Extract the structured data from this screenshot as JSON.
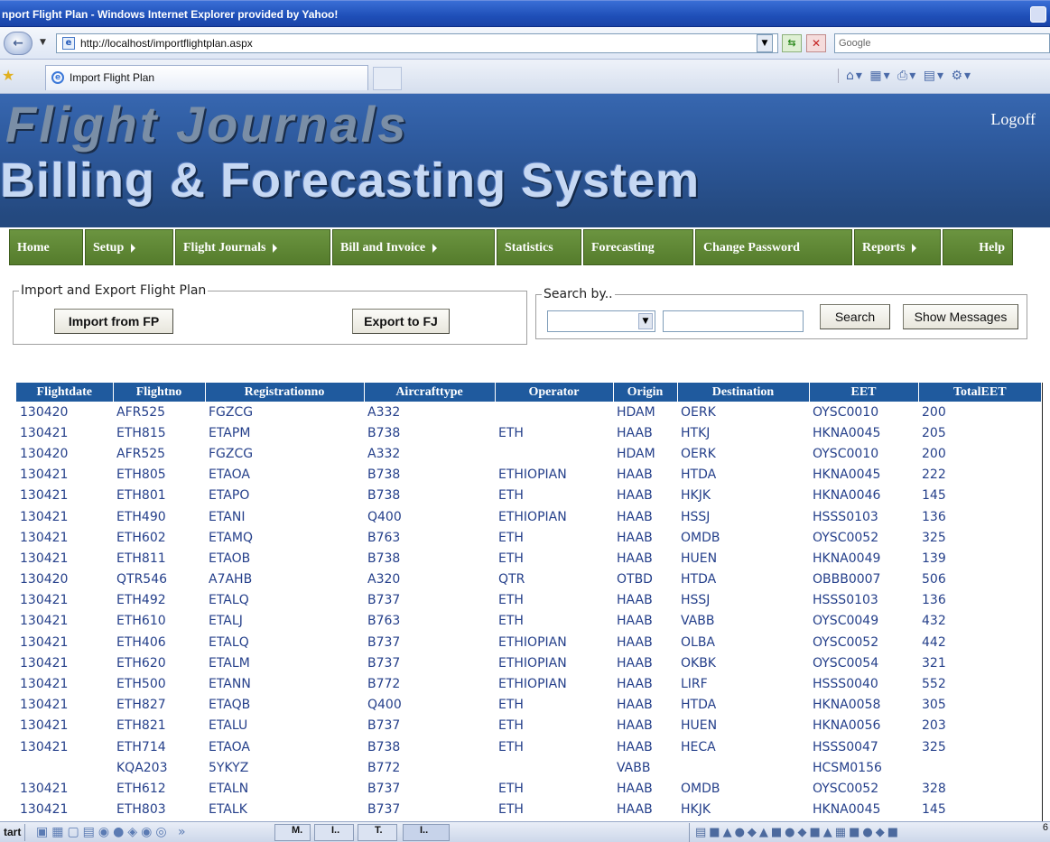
{
  "window": {
    "title": "nport Flight Plan - Windows Internet Explorer provided by Yahoo!"
  },
  "address": {
    "url": "http://localhost/importflightplan.aspx",
    "search_placeholder": "Google"
  },
  "tab": {
    "label": "Import Flight Plan"
  },
  "banner": {
    "line1": "Flight Journals",
    "line2": "Billing & Forecasting System",
    "logoff": "Logoff"
  },
  "menu": [
    {
      "label": "Home",
      "arrow": false
    },
    {
      "label": "Setup",
      "arrow": true
    },
    {
      "label": "Flight Journals",
      "arrow": true
    },
    {
      "label": "Bill and Invoice",
      "arrow": true
    },
    {
      "label": "Statistics",
      "arrow": false
    },
    {
      "label": "Forecasting",
      "arrow": false
    },
    {
      "label": "Change Password",
      "arrow": false
    },
    {
      "label": "Reports",
      "arrow": true
    },
    {
      "label": "Help",
      "arrow": false
    }
  ],
  "import_panel": {
    "legend": "Import and Export Flight Plan",
    "import_button": "Import from FP",
    "export_button": "Export to FJ"
  },
  "search_panel": {
    "legend": "Search by..",
    "search_button": "Search",
    "messages_button": "Show Messages"
  },
  "grid": {
    "columns": [
      "Flightdate",
      "Flightno",
      "Registrationno",
      "Aircrafttype",
      "Operator",
      "Origin",
      "Destination",
      "EET",
      "TotalEET"
    ],
    "rows": [
      [
        "130420",
        "AFR525",
        "FGZCG",
        "A332",
        "",
        "HDAM",
        "OERK",
        "OYSC0010",
        "200"
      ],
      [
        "130421",
        "ETH815",
        "ETAPM",
        "B738",
        "ETH",
        "HAAB",
        "HTKJ",
        "HKNA0045",
        "205"
      ],
      [
        "130420",
        "AFR525",
        "FGZCG",
        "A332",
        "",
        "HDAM",
        "OERK",
        "OYSC0010",
        "200"
      ],
      [
        "130421",
        "ETH805",
        "ETAOA",
        "B738",
        "ETHIOPIAN",
        "HAAB",
        "HTDA",
        "HKNA0045",
        "222"
      ],
      [
        "130421",
        "ETH801",
        "ETAPO",
        "B738",
        "ETH",
        "HAAB",
        "HKJK",
        "HKNA0046",
        "145"
      ],
      [
        "130421",
        "ETH490",
        "ETANI",
        "Q400",
        "ETHIOPIAN",
        "HAAB",
        "HSSJ",
        "HSSS0103",
        "136"
      ],
      [
        "130421",
        "ETH602",
        "ETAMQ",
        "B763",
        "ETH",
        "HAAB",
        "OMDB",
        "OYSC0052",
        "325"
      ],
      [
        "130421",
        "ETH811",
        "ETAOB",
        "B738",
        "ETH",
        "HAAB",
        "HUEN",
        "HKNA0049",
        "139"
      ],
      [
        "130420",
        "QTR546",
        "A7AHB",
        "A320",
        "QTR",
        "OTBD",
        "HTDA",
        "OBBB0007",
        "506"
      ],
      [
        "130421",
        "ETH492",
        "ETALQ",
        "B737",
        "ETH",
        "HAAB",
        "HSSJ",
        "HSSS0103",
        "136"
      ],
      [
        "130421",
        "ETH610",
        "ETALJ",
        "B763",
        "ETH",
        "HAAB",
        "VABB",
        "OYSC0049",
        "432"
      ],
      [
        "130421",
        "ETH406",
        "ETALQ",
        "B737",
        "ETHIOPIAN",
        "HAAB",
        "OLBA",
        "OYSC0052",
        "442"
      ],
      [
        "130421",
        "ETH620",
        "ETALM",
        "B737",
        "ETHIOPIAN",
        "HAAB",
        "OKBK",
        "OYSC0054",
        "321"
      ],
      [
        "130421",
        "ETH500",
        "ETANN",
        "B772",
        "ETHIOPIAN",
        "HAAB",
        "LIRF",
        "HSSS0040",
        "552"
      ],
      [
        "130421",
        "ETH827",
        "ETAQB",
        "Q400",
        "ETH",
        "HAAB",
        "HTDA",
        "HKNA0058",
        "305"
      ],
      [
        "130421",
        "ETH821",
        "ETALU",
        "B737",
        "ETH",
        "HAAB",
        "HUEN",
        "HKNA0056",
        "203"
      ],
      [
        "130421",
        "ETH714",
        "ETAOA",
        "B738",
        "ETH",
        "HAAB",
        "HECA",
        "HSSS0047",
        "325"
      ],
      [
        "",
        "KQA203",
        "5YKYZ",
        "B772",
        "",
        "VABB",
        "",
        "HCSM0156",
        ""
      ],
      [
        "130421",
        "ETH612",
        "ETALN",
        "B737",
        "ETH",
        "HAAB",
        "OMDB",
        "OYSC0052",
        "328"
      ],
      [
        "130421",
        "ETH803",
        "ETALK",
        "B737",
        "ETH",
        "HAAB",
        "HKJK",
        "HKNA0045",
        "145"
      ]
    ]
  },
  "taskbar": {
    "start": "tart",
    "buttons": [
      "M.",
      "I..",
      "T.",
      "I.."
    ],
    "clock": "6"
  },
  "colors": {
    "banner": "#2e5a9e",
    "menu": "#5e8734",
    "grid_header": "#1f5a9e",
    "grid_text": "#243f8a"
  }
}
